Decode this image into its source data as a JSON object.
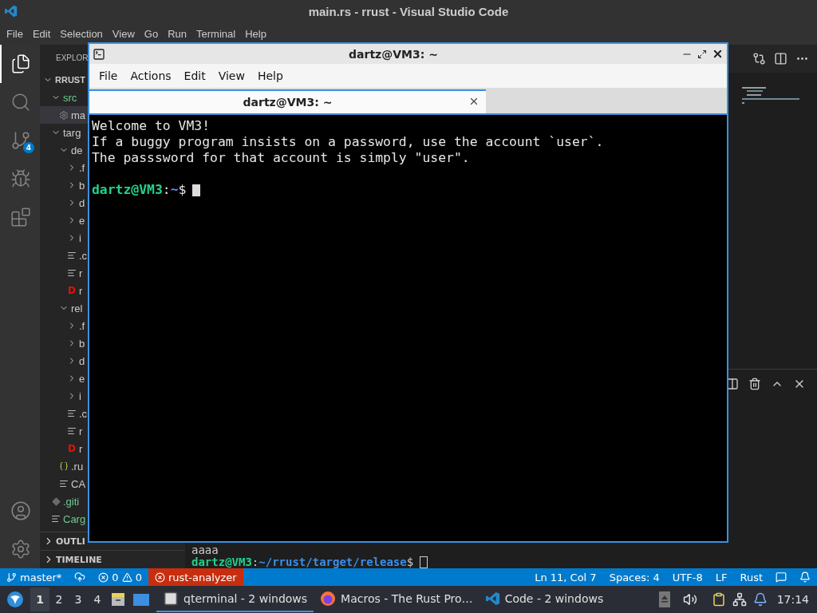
{
  "window": {
    "title": "main.rs - rrust - Visual Studio Code"
  },
  "menu": [
    "File",
    "Edit",
    "Selection",
    "View",
    "Go",
    "Run",
    "Terminal",
    "Help"
  ],
  "activity_bar": {
    "top": [
      {
        "kind": "files",
        "selected": true
      },
      {
        "kind": "search",
        "selected": false
      },
      {
        "kind": "source_control",
        "selected": false,
        "badge": "4"
      },
      {
        "kind": "debug",
        "selected": false
      },
      {
        "kind": "extensions",
        "selected": false
      }
    ],
    "bottom": [
      {
        "kind": "account"
      },
      {
        "kind": "settings"
      }
    ]
  },
  "explorer": {
    "title": "EXPLOR",
    "tree": [
      {
        "label": "RRUST",
        "kind": "root",
        "expanded": true,
        "children": [
          {
            "label": "src",
            "kind": "folder",
            "expanded": true,
            "color": "#73c991",
            "children": [
              {
                "label": "ma",
                "kind": "rust",
                "selected": true
              }
            ]
          },
          {
            "label": "targ",
            "kind": "folder",
            "expanded": true,
            "children": [
              {
                "label": "de",
                "kind": "folder",
                "expanded": true,
                "children": [
                  {
                    "label": ".f",
                    "kind": "folder",
                    "expanded": false
                  },
                  {
                    "label": "b",
                    "kind": "folder",
                    "expanded": false
                  },
                  {
                    "label": "d",
                    "kind": "folder",
                    "expanded": false
                  },
                  {
                    "label": "e",
                    "kind": "folder",
                    "expanded": false
                  },
                  {
                    "label": "i",
                    "kind": "folder",
                    "expanded": false
                  },
                  {
                    "label": ".c",
                    "kind": "text"
                  },
                  {
                    "label": "r",
                    "kind": "text"
                  },
                  {
                    "label": "r",
                    "kind": "d",
                    "glyph": "D"
                  }
                ]
              },
              {
                "label": "rel",
                "kind": "folder",
                "expanded": true,
                "children": [
                  {
                    "label": ".f",
                    "kind": "folder",
                    "expanded": false
                  },
                  {
                    "label": "b",
                    "kind": "folder",
                    "expanded": false
                  },
                  {
                    "label": "d",
                    "kind": "folder",
                    "expanded": false
                  },
                  {
                    "label": "e",
                    "kind": "folder",
                    "expanded": false
                  },
                  {
                    "label": "i",
                    "kind": "folder",
                    "expanded": false
                  },
                  {
                    "label": ".c",
                    "kind": "text"
                  },
                  {
                    "label": "r",
                    "kind": "text"
                  },
                  {
                    "label": "r",
                    "kind": "d",
                    "glyph": "D"
                  }
                ]
              },
              {
                "label": ".ru",
                "kind": "json"
              },
              {
                "label": "CA",
                "kind": "text"
              }
            ]
          },
          {
            "label": ".giti",
            "kind": "git",
            "color": "#73c991"
          },
          {
            "label": "Carg",
            "kind": "text",
            "color": "#73c991"
          }
        ]
      }
    ]
  },
  "sections": [
    {
      "label": "OUTLI",
      "expanded": false
    },
    {
      "label": "TIMELINE",
      "expanded": false
    }
  ],
  "panel": {
    "lines": [
      {
        "kind": "output",
        "text": "aaaa"
      },
      {
        "kind": "prompt",
        "user_host": "dartz@VM3",
        "separator": ":",
        "path": "~/rrust/target/release",
        "symbol": "$"
      }
    ]
  },
  "terminal_window": {
    "title": "dartz@VM3: ~",
    "menu": [
      "File",
      "Actions",
      "Edit",
      "View",
      "Help"
    ],
    "tabs": [
      {
        "label": "dartz@VM3: ~",
        "selected": true
      }
    ],
    "lines": [
      {
        "kind": "output",
        "text": "Welcome to VM3!"
      },
      {
        "kind": "output",
        "text": "If a buggy program insists on a password, use the account `user`."
      },
      {
        "kind": "output",
        "text": "The passsword for that account is simply \"user\"."
      },
      {
        "kind": "blank"
      },
      {
        "kind": "prompt",
        "user_host": "dartz@VM3",
        "separator": ":",
        "path": "~",
        "symbol": "$"
      }
    ]
  },
  "status_bar": {
    "branch": "master*",
    "errors": "0",
    "warnings": "0",
    "language_server": "rust-analyzer",
    "right": [
      "Ln 11, Col 7",
      "Spaces: 4",
      "UTF-8",
      "LF",
      "Rust"
    ]
  },
  "taskbar": {
    "workspaces": [
      {
        "label": "1",
        "selected": true
      },
      {
        "label": "2",
        "selected": false
      },
      {
        "label": "3",
        "selected": false
      },
      {
        "label": "4",
        "selected": false
      }
    ],
    "tasks": [
      {
        "label": "qterminal - 2 windows",
        "kind": "terminal",
        "selected": true
      },
      {
        "label": "Macros - The Rust Pro…",
        "kind": "browser",
        "selected": false
      },
      {
        "label": "Code - 2 windows",
        "kind": "code",
        "selected": false
      }
    ],
    "clock": "17:14"
  }
}
